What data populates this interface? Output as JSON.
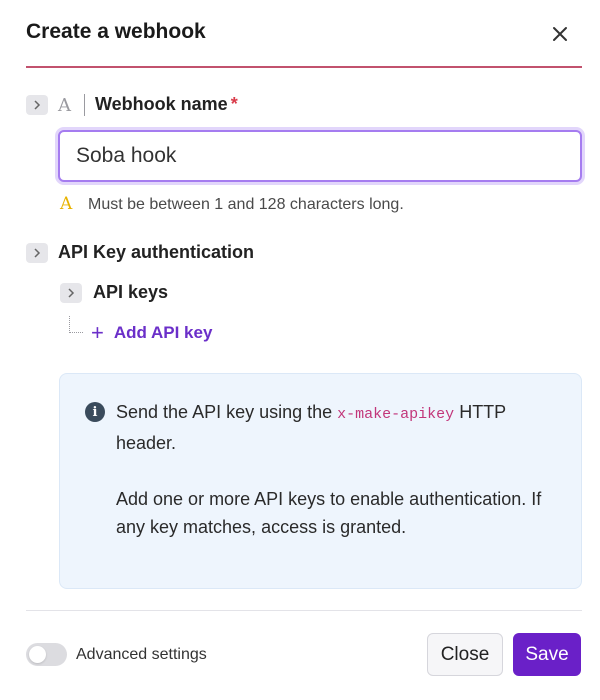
{
  "header": {
    "title": "Create a webhook",
    "close_icon": "close-icon"
  },
  "webhook_name": {
    "type_glyph": "A",
    "label": "Webhook name",
    "required_mark": "*",
    "value": "Soba hook",
    "hint_glyph": "A",
    "hint": "Must be between 1 and 128 characters long."
  },
  "api_auth": {
    "label": "API Key authentication",
    "api_keys_label": "API keys",
    "add_label": "Add API key",
    "add_glyph": "+"
  },
  "info": {
    "icon_glyph": "i",
    "line1_pre": "Send the API key using the ",
    "code": "x-make-apikey",
    "line1_post": " HTTP header.",
    "line2": "Add one or more API keys to enable authentication. If any key matches, access is granted."
  },
  "footer": {
    "advanced_label": "Advanced settings",
    "advanced_enabled": false,
    "close_label": "Close",
    "save_label": "Save"
  },
  "colors": {
    "accent": "#6a20c8",
    "header_rule": "#c2526e",
    "required": "#d93b4a",
    "hint_icon": "#e8b300",
    "code_text": "#c2367a",
    "info_bg": "#eef5fd"
  }
}
